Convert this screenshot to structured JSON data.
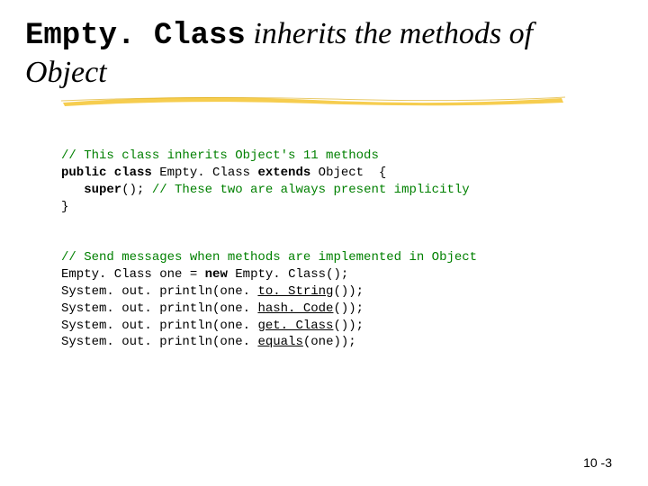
{
  "title": {
    "part1": "Empty. Class",
    "part2": " inherits the methods of ",
    "part3": "Object"
  },
  "code1": {
    "l1": "// This class inherits Object's 11 methods",
    "l2a": "public class",
    "l2b": " Empty. Class ",
    "l2c": "extends",
    "l2d": " Object  {",
    "l3a": "   super",
    "l3b": "(); ",
    "l3c": "// These two are always present implicitly",
    "l4": "}"
  },
  "code2": {
    "l1": "// Send messages when methods are implemented in Object",
    "l2a": "Empty. Class one = ",
    "l2b": "new",
    "l2c": " Empty. Class();",
    "l3a": "System. out. println(one. ",
    "l3b": "to. String",
    "l3c": "());",
    "l4a": "System. out. println(one. ",
    "l4b": "hash. Code",
    "l4c": "());",
    "l5a": "System. out. println(one. ",
    "l5b": "get. Class",
    "l5c": "());",
    "l6a": "System. out. println(one. ",
    "l6b": "equals",
    "l6c": "(one));"
  },
  "pagenum": "10 -3"
}
